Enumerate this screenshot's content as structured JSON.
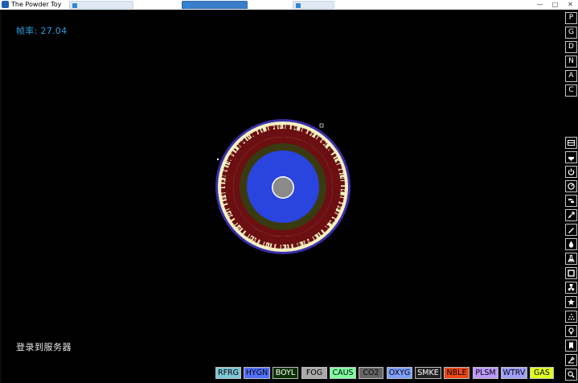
{
  "window": {
    "title": "The Powder Toy",
    "background_tabs": [
      "",
      "",
      ""
    ]
  },
  "hud": {
    "fps": "帧率: 27.04",
    "login": "登录到服务器"
  },
  "mode_buttons": [
    "P",
    "G",
    "D",
    "N",
    "A",
    "C"
  ],
  "category_icons": [
    "wall-icon",
    "electronics-icon",
    "power-icon",
    "explosives-icon",
    "sensors-icon",
    "force-icon",
    "solids-icon",
    "liquids-icon",
    "gases-icon",
    "special-icon",
    "radioactive-icon",
    "life-icon",
    "powders-icon",
    "tools-icon",
    "favorites-icon",
    "bookmark-icon",
    "misc-icon",
    "search-icon"
  ],
  "elements": [
    {
      "label": "RFRG",
      "bg": "#7fc6d6",
      "fg": "#000000"
    },
    {
      "label": "HYGN",
      "bg": "#5070ff",
      "fg": "#000000"
    },
    {
      "label": "BOYL",
      "bg": "#0a3200",
      "fg": "#ffffff"
    },
    {
      "label": "FOG",
      "bg": "#aaaaaa",
      "fg": "#000000"
    },
    {
      "label": "CAUS",
      "bg": "#80ffa0",
      "fg": "#000000"
    },
    {
      "label": "CO2",
      "bg": "#666666",
      "fg": "#000000"
    },
    {
      "label": "OXYG",
      "bg": "#80a0ff",
      "fg": "#000000"
    },
    {
      "label": "SMKE",
      "bg": "#222222",
      "fg": "#ffffff"
    },
    {
      "label": "NBLE",
      "bg": "#eb4917",
      "fg": "#000000"
    },
    {
      "label": "PLSM",
      "bg": "#bb99ff",
      "fg": "#000000"
    },
    {
      "label": "WTRV",
      "bg": "#a0a0ff",
      "fg": "#000000"
    },
    {
      "label": "GAS",
      "bg": "#e0ff20",
      "fg": "#000000"
    }
  ],
  "colors": {
    "fps_text": "#2a9fdb",
    "ring_outer": "#3a2fa8",
    "ring_cream": "#f5f0c0",
    "ring_maroon": "#6b0f12",
    "ring_olive": "#3a3a10",
    "core_blue": "#2a44e0",
    "center": "#8a8a8a"
  }
}
